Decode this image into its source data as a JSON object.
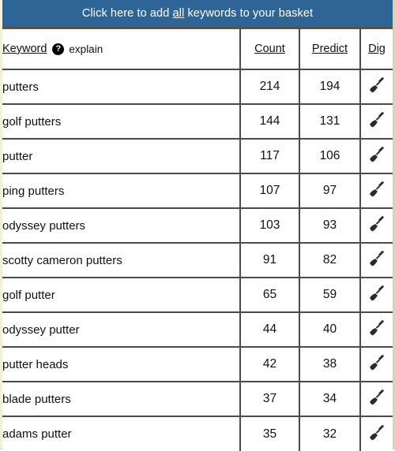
{
  "banner": {
    "text_before": "Click here to add ",
    "text_underlined": "all",
    "text_after": " keywords to your basket",
    "background_color": "#2e6496",
    "text_color": "#ffffff"
  },
  "table": {
    "headers": {
      "keyword": "Keyword",
      "help_icon": "question-mark-icon",
      "explain": "explain",
      "count": "Count",
      "predict": "Predict",
      "dig": "Dig"
    },
    "count_column_background": "#eeeeee",
    "dig_icon_name": "trowel-icon",
    "rows": [
      {
        "keyword": "putters",
        "count": "214",
        "predict": "194"
      },
      {
        "keyword": "golf putters",
        "count": "144",
        "predict": "131"
      },
      {
        "keyword": "putter",
        "count": "117",
        "predict": "106"
      },
      {
        "keyword": "ping putters",
        "count": "107",
        "predict": "97"
      },
      {
        "keyword": "odyssey putters",
        "count": "103",
        "predict": "93"
      },
      {
        "keyword": "scotty cameron putters",
        "count": "91",
        "predict": "82"
      },
      {
        "keyword": "golf putter",
        "count": "65",
        "predict": "59"
      },
      {
        "keyword": "odyssey putter",
        "count": "44",
        "predict": "40"
      },
      {
        "keyword": "putter heads",
        "count": "42",
        "predict": "38"
      },
      {
        "keyword": "blade putters",
        "count": "37",
        "predict": "34"
      },
      {
        "keyword": "adams putter",
        "count": "35",
        "predict": "32"
      }
    ]
  }
}
